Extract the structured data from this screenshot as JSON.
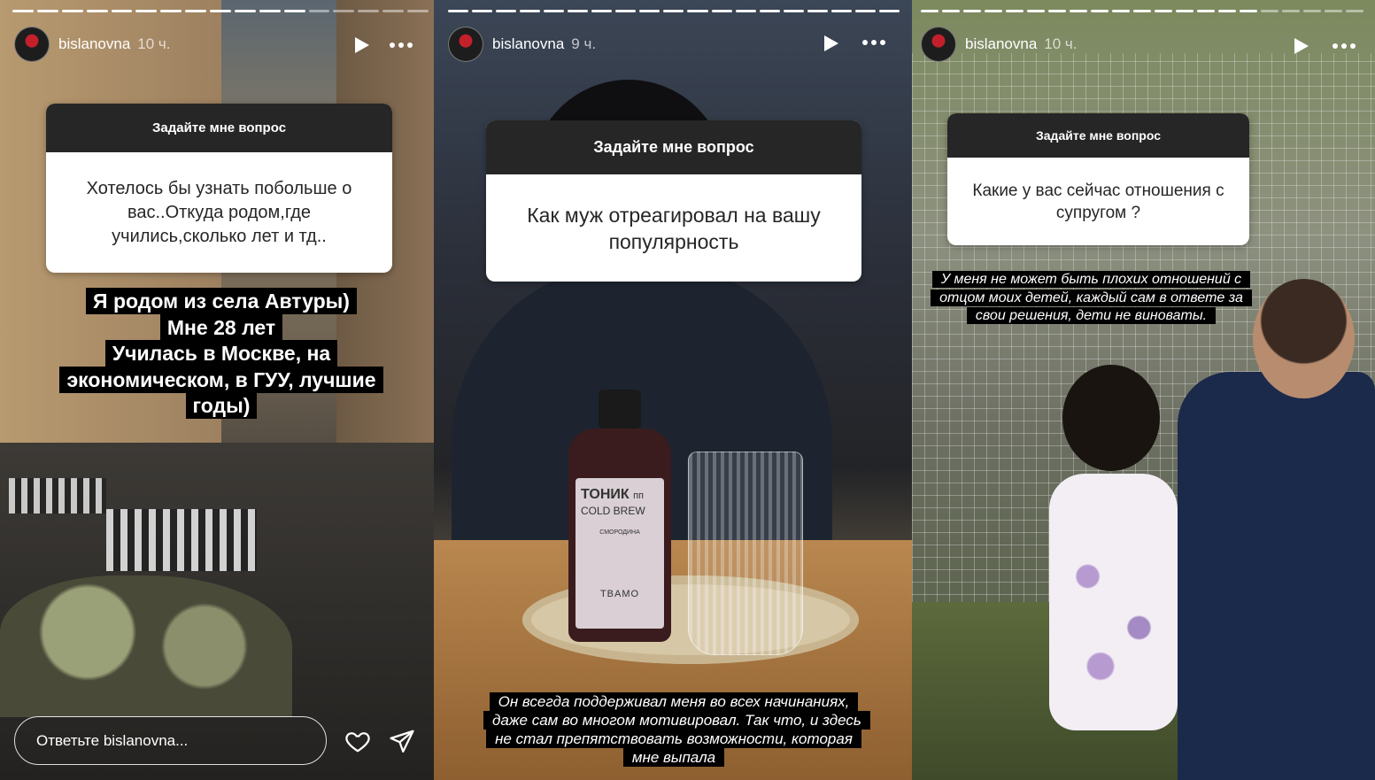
{
  "stories": [
    {
      "username": "bislanovna",
      "time": "10 ч.",
      "question_title": "Задайте мне вопрос",
      "question_text": "Хотелось бы узнать побольше о вас..Откуда родом,где учились,сколько лет и тд..",
      "answer_lines": [
        "Я родом из села Автуры)",
        "Мне 28 лет",
        "Училась в Москве, на экономическом, в ГУУ, лучшие годы)"
      ],
      "reply_placeholder": "Ответьте bislanovna...",
      "icons": [
        "play-icon",
        "more-icon",
        "heart-icon",
        "send-icon"
      ]
    },
    {
      "username": "bislanovna",
      "time": "9 ч.",
      "question_title": "Задайте мне вопрос",
      "question_text": "Как муж отреагировал на вашу популярность",
      "answer_text": "Он всегда поддерживал меня во всех начинаниях, даже сам во многом мотивировал. Так что, и здесь не стал препятствовать возможности, которая мне выпала",
      "bottle_label": {
        "line1": "ТОНИК",
        "line1_suffix": "пп",
        "line2": "COLD BREW",
        "line3": "СМОРОДИНА",
        "brand": "TBAMO"
      },
      "icons": [
        "play-icon",
        "more-icon"
      ]
    },
    {
      "username": "bislanovna",
      "time": "10 ч.",
      "question_title": "Задайте мне вопрос",
      "question_text": "Какие у вас сейчас отношения с супругом ?",
      "answer_text": "У меня не может быть плохих отношений с отцом моих детей, каждый сам в ответе за свои решения, дети не виноваты.",
      "icons": [
        "play-icon",
        "more-icon"
      ]
    }
  ],
  "colors": {
    "question_header_bg": "#262626",
    "question_body_bg": "#ffffff",
    "highlight_bg": "#000000",
    "text_light": "#ffffff"
  }
}
